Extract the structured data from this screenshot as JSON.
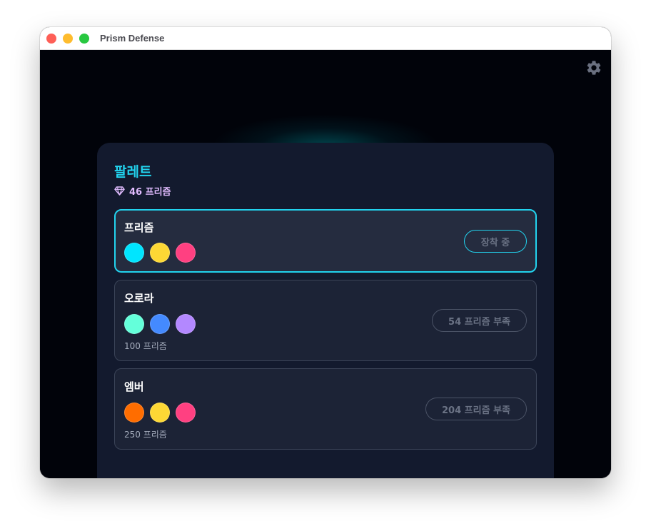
{
  "window": {
    "title": "Prism Defense"
  },
  "colors": {
    "accent": "#22d3ee",
    "currency": "#e1bcff",
    "panel_bg": "#131a2e"
  },
  "icons": {
    "settings": "gear-icon",
    "currency": "gem-icon"
  },
  "panel": {
    "title": "팔레트",
    "balance": "46 프리즘"
  },
  "palettes": [
    {
      "name": "프리즘",
      "colors": [
        "#00e5ff",
        "#fdd835",
        "#ff4081"
      ],
      "price": "",
      "status": "equipped",
      "button_label": "장착 중"
    },
    {
      "name": "오로라",
      "colors": [
        "#64ffda",
        "#448aff",
        "#b388ff"
      ],
      "price": "100 프리즘",
      "status": "insufficient",
      "button_label": "54 프리즘 부족"
    },
    {
      "name": "엠버",
      "colors": [
        "#ff6d00",
        "#fdd835",
        "#ff4081"
      ],
      "price": "250 프리즘",
      "status": "insufficient",
      "button_label": "204 프리즘 부족"
    }
  ]
}
